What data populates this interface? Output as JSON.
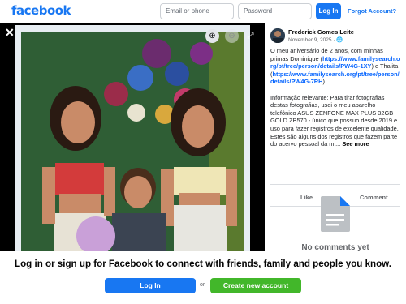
{
  "header": {
    "logo": "facebook",
    "email_placeholder": "Email or phone",
    "password_placeholder": "Password",
    "login_label": "Log In",
    "forgot_label": "Forgot Account?"
  },
  "post": {
    "author": "Frederick Gomes Leite",
    "date": "November 9, 2025 · ",
    "text_1": "O meu aniversário de 2 anos, com minhas primas Dominique (",
    "link_1": "https://www.familysearch.org/pt/tree/person/details/PW4G-1XY",
    "text_2": ") e Thalita (",
    "link_2": "https://www.familysearch.org/pt/tree/person/details/PW4G-7RH",
    "text_3": ").",
    "text_4": "Informação relevante: Para tirar fotografias destas fotografias, usei o meu aparelho telefônico ASUS ZENFONE MAX PLUS 32GB GOLD ZB570 - único que possuo desde 2019 e uso para fazer registros de excelente qualidade. Estes são alguns dos registros que fazem parte do acervo pessoal da mi... ",
    "see_more": "See more",
    "like_label": "Like",
    "comment_label": "Comment",
    "no_comments": "No comments yet"
  },
  "banner": {
    "text": "Log in or sign up for Facebook to connect with friends, family and people you know.",
    "login_label": "Log In",
    "or_label": "or",
    "create_label": "Create new account"
  },
  "icons": {
    "close": "close-icon",
    "zoom_in": "zoom-in-icon",
    "zoom_out": "zoom-out-icon",
    "fullscreen": "fullscreen-icon",
    "document": "document-icon"
  },
  "colors": {
    "brand": "#1877f2",
    "create": "#42b72a",
    "viewer_bg": "#000000"
  }
}
